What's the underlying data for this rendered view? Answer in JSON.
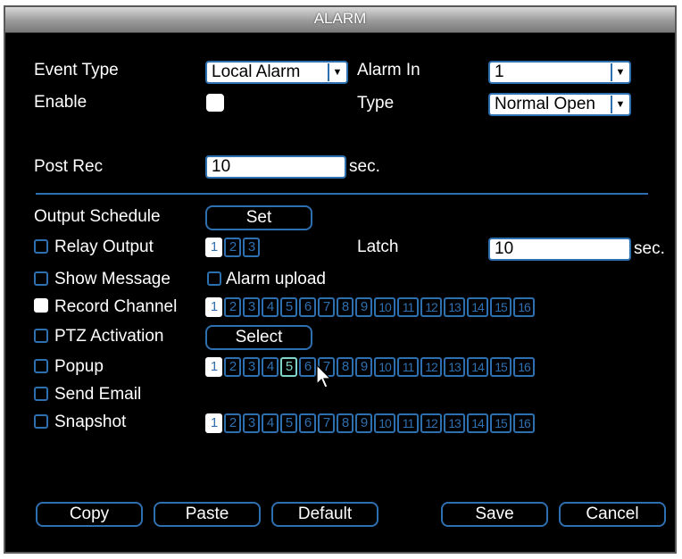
{
  "window": {
    "title": "ALARM"
  },
  "event_type": {
    "label": "Event Type",
    "value": "Local Alarm"
  },
  "alarm_in": {
    "label": "Alarm In",
    "value": "1"
  },
  "enable": {
    "label": "Enable",
    "checked": false
  },
  "type": {
    "label": "Type",
    "value": "Normal Open"
  },
  "post_rec": {
    "label": "Post Rec",
    "value": "10",
    "unit": "sec."
  },
  "output_schedule": {
    "label": "Output Schedule",
    "button": "Set"
  },
  "relay_output": {
    "label": "Relay Output",
    "channels": [
      "1",
      "2",
      "3"
    ],
    "selected": [
      1
    ]
  },
  "latch": {
    "label": "Latch",
    "value": "10",
    "unit": "sec."
  },
  "show_message": {
    "label": "Show Message"
  },
  "alarm_upload": {
    "label": "Alarm upload"
  },
  "record_channel": {
    "label": "Record Channel",
    "selected": [
      1
    ]
  },
  "ptz_activation": {
    "label": "PTZ Activation",
    "button": "Select"
  },
  "popup": {
    "label": "Popup",
    "selected": [
      1
    ],
    "hover": 5
  },
  "send_email": {
    "label": "Send Email"
  },
  "snapshot": {
    "label": "Snapshot",
    "selected": [
      1
    ]
  },
  "channels": [
    "1",
    "2",
    "3",
    "4",
    "5",
    "6",
    "7",
    "8",
    "9",
    "10",
    "11",
    "12",
    "13",
    "14",
    "15",
    "16"
  ],
  "buttons": {
    "copy": "Copy",
    "paste": "Paste",
    "default": "Default",
    "save": "Save",
    "cancel": "Cancel"
  },
  "colors": {
    "accent": "#2e6fb0",
    "background": "#000000",
    "hover": "#7fd6c8"
  }
}
